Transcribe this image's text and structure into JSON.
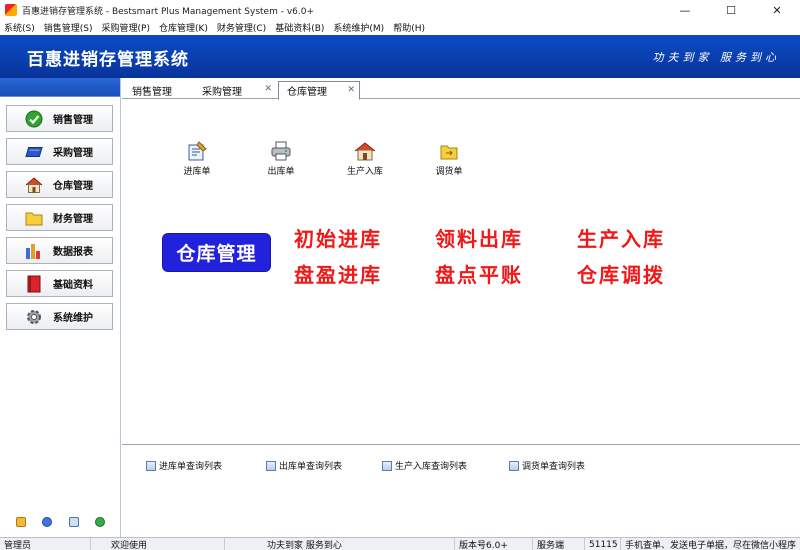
{
  "window": {
    "title": "百惠进销存管理系统 - Bestsmart Plus Management System - v6.0+",
    "controls": [
      "—",
      "☐",
      "✕"
    ]
  },
  "menu": [
    "系统(S)",
    "销售管理(S)",
    "采购管理(P)",
    "仓库管理(K)",
    "财务管理(C)",
    "基础资料(B)",
    "系统维护(M)",
    "帮助(H)"
  ],
  "banner": {
    "title": "百惠进销存管理系统",
    "slogan": "功夫到家 服务到心"
  },
  "sidebar": {
    "items": [
      {
        "label": "销售管理",
        "icon": "check-circle-icon"
      },
      {
        "label": "采购管理",
        "icon": "blue-card-icon"
      },
      {
        "label": "仓库管理",
        "icon": "house-icon"
      },
      {
        "label": "财务管理",
        "icon": "folder-icon"
      },
      {
        "label": "数据报表",
        "icon": "bar-report-icon"
      },
      {
        "label": "基础资料",
        "icon": "red-book-icon"
      },
      {
        "label": "系统维护",
        "icon": "gear-icon"
      }
    ],
    "footer_icons": [
      "edit-icon",
      "info-icon",
      "window-icon",
      "exit-icon"
    ]
  },
  "tabs": [
    {
      "label": "销售管理",
      "closable": false,
      "active": false
    },
    {
      "label": "采购管理",
      "closable": true,
      "active": false
    },
    {
      "label": "仓库管理",
      "closable": true,
      "active": true
    }
  ],
  "toolbar": [
    {
      "label": "进库单",
      "icon": "inbound-doc-icon"
    },
    {
      "label": "出库单",
      "icon": "printer-icon"
    },
    {
      "label": "生产入库",
      "icon": "house-icon"
    },
    {
      "label": "调货单",
      "icon": "folder-transfer-icon"
    }
  ],
  "module_badge": "仓库管理",
  "functions": [
    "初始进库",
    "领料出库",
    "生产入库",
    "盘盈进库",
    "盘点平账",
    "仓库调拨"
  ],
  "queries": [
    "进库单查询列表",
    "出库单查询列表",
    "生产入库查询列表",
    "调货单查询列表"
  ],
  "status": {
    "user": "管理员",
    "welcome": "欢迎使用",
    "slogan": "功夫到家 服务到心",
    "version": "版本号6.0+",
    "mode": "服务端",
    "port": "51115",
    "marquee": "手机查单、发送电子单据，尽在微信小程序"
  }
}
